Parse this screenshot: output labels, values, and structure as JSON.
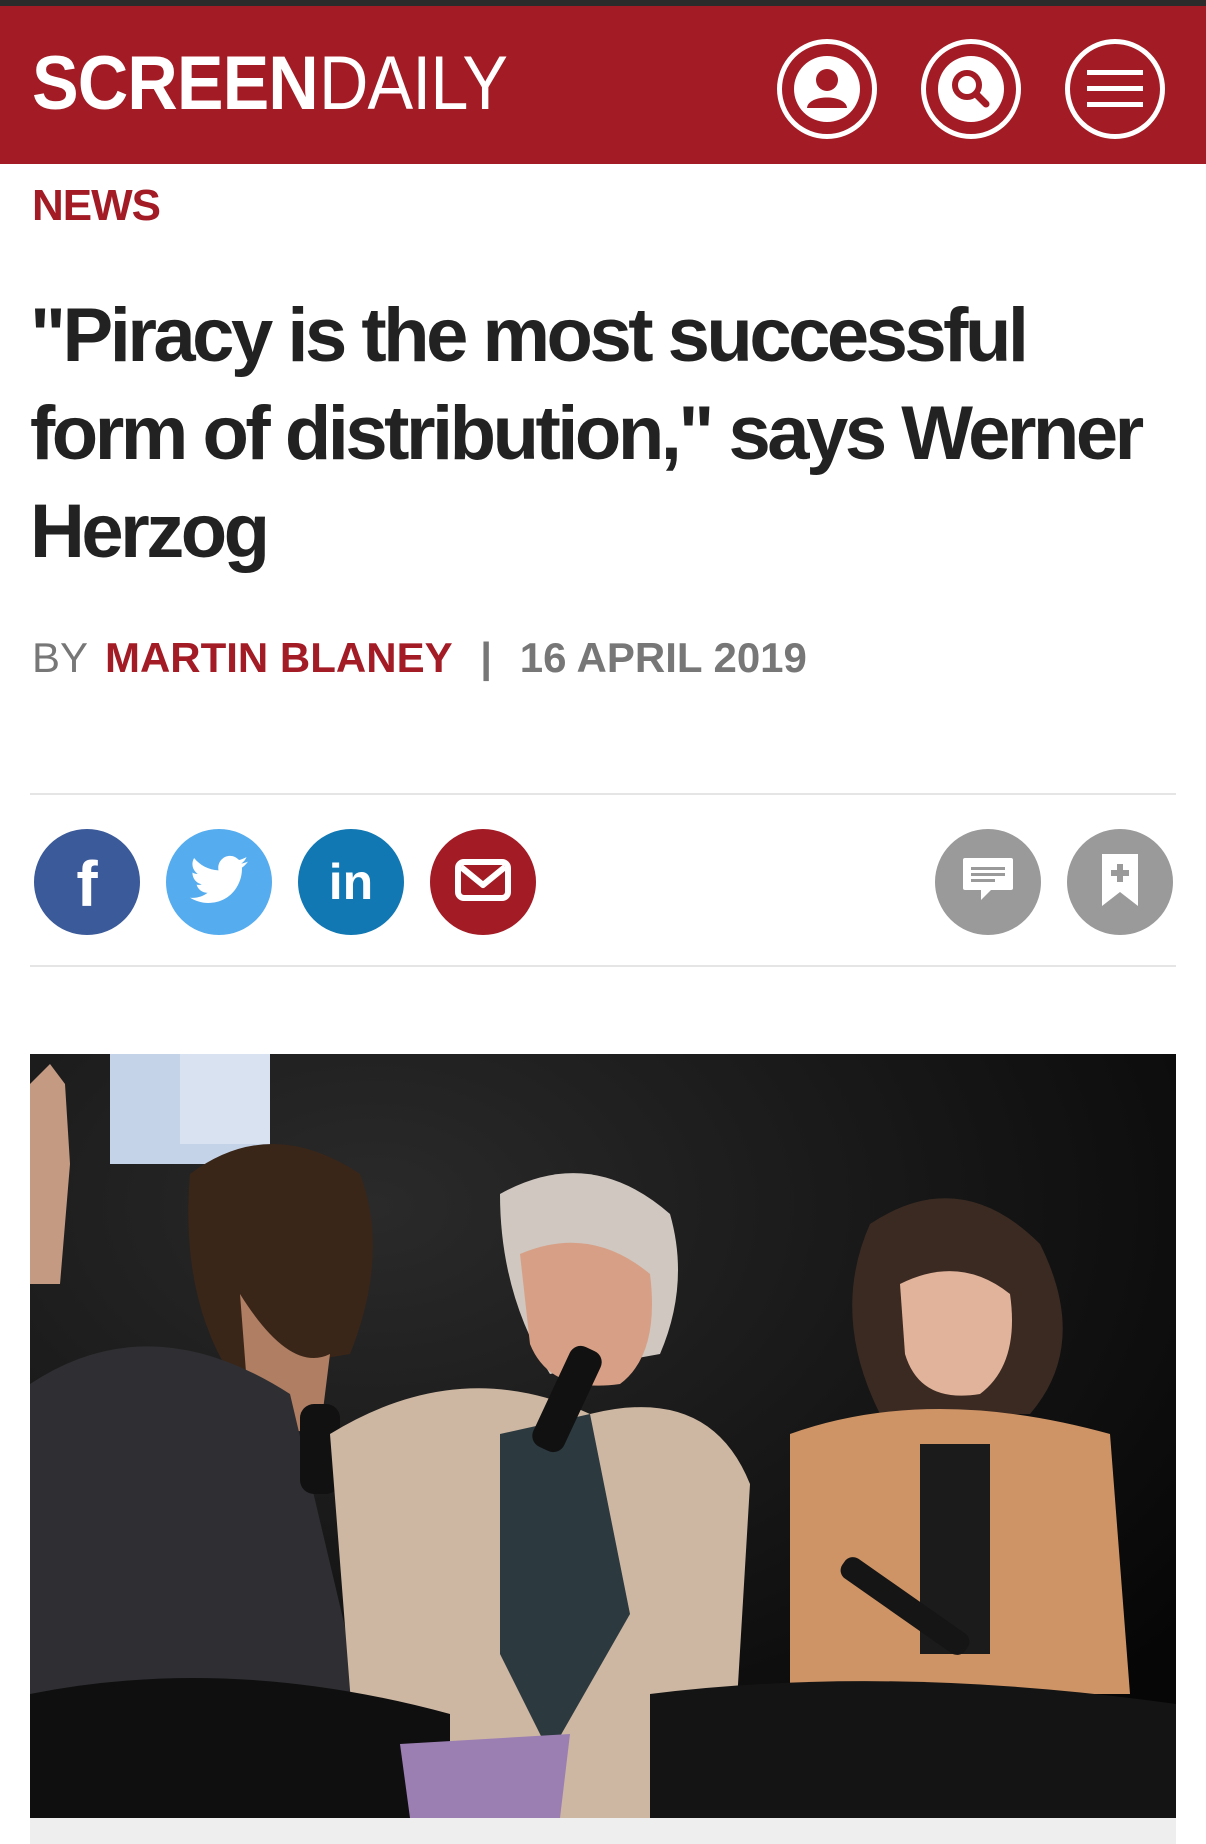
{
  "site": {
    "logo_bold": "SCREEN",
    "logo_light": "DAILY",
    "brand_color": "#a31b25",
    "icons": [
      "user-icon",
      "search-icon",
      "menu-icon"
    ]
  },
  "article": {
    "section": "NEWS",
    "headline": "\"Piracy is the most successful form of distribution,\" says Werner Herzog",
    "by_prefix": "BY",
    "author": "MARTIN BLANEY",
    "separator": "|",
    "date": "16 APRIL 2019"
  },
  "share": {
    "buttons": [
      {
        "name": "facebook",
        "glyph": "f",
        "color": "#3b5a9a"
      },
      {
        "name": "twitter",
        "icon": "twitter-bird-icon",
        "color": "#55acee"
      },
      {
        "name": "linkedin",
        "glyph": "in",
        "color": "#1178b3"
      },
      {
        "name": "email",
        "icon": "envelope-icon",
        "color": "#a31b25"
      }
    ],
    "actions": [
      {
        "name": "comments",
        "icon": "comment-icon",
        "color": "#9a9a9a"
      },
      {
        "name": "bookmark",
        "icon": "bookmark-add-icon",
        "color": "#9a9a9a"
      }
    ]
  }
}
